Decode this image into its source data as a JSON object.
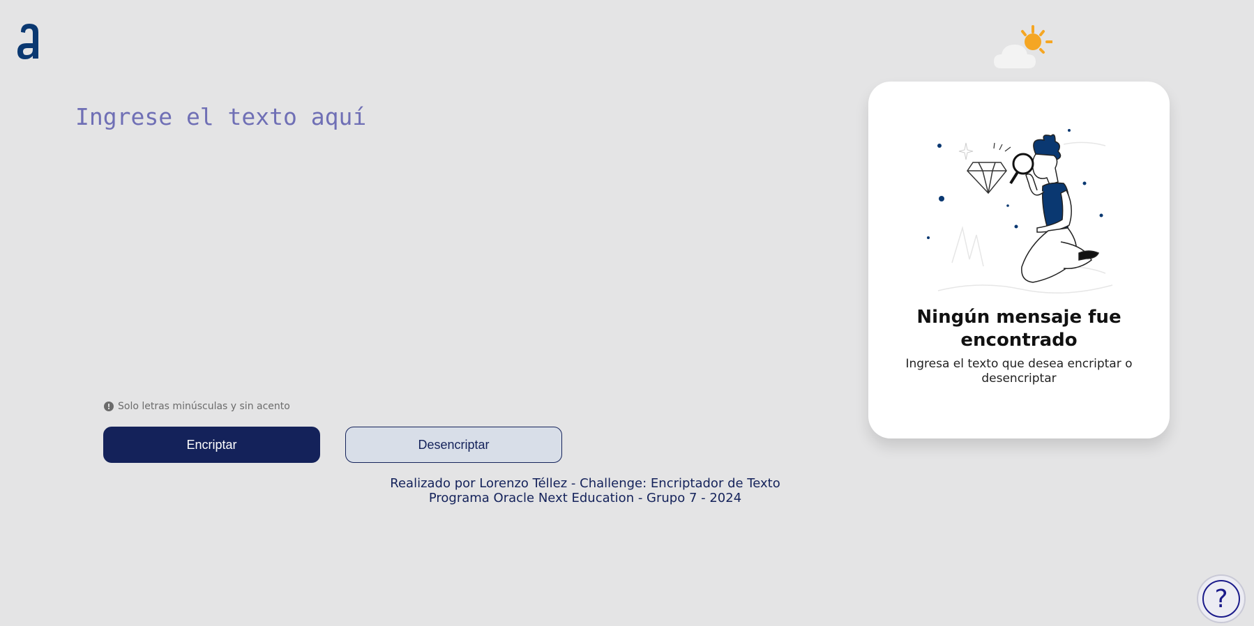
{
  "app": {
    "logo_letter": "a",
    "accent_color": "#0a3871",
    "button_primary_color": "#14225a"
  },
  "input": {
    "placeholder": "Ingrese el texto aquí",
    "value": ""
  },
  "hint": {
    "icon": "exclamation-circle-icon",
    "text": "Solo letras minúsculas y sin acento"
  },
  "buttons": {
    "encrypt_label": "Encriptar",
    "decrypt_label": "Desencriptar"
  },
  "footer": {
    "line1": "Realizado por Lorenzo Téllez - Challenge: Encriptador de Texto",
    "line2": "Programa Oracle Next Education - Grupo 7 - 2024"
  },
  "weather_icon": "sun-behind-cloud-icon",
  "output_card": {
    "illustration": "person-with-magnifying-glass-and-diamond",
    "title": "Ningún mensaje fue encontrado",
    "subtitle": "Ingresa el texto que desea encriptar o desencriptar"
  },
  "help": {
    "icon": "question-mark-icon",
    "symbol": "?"
  }
}
